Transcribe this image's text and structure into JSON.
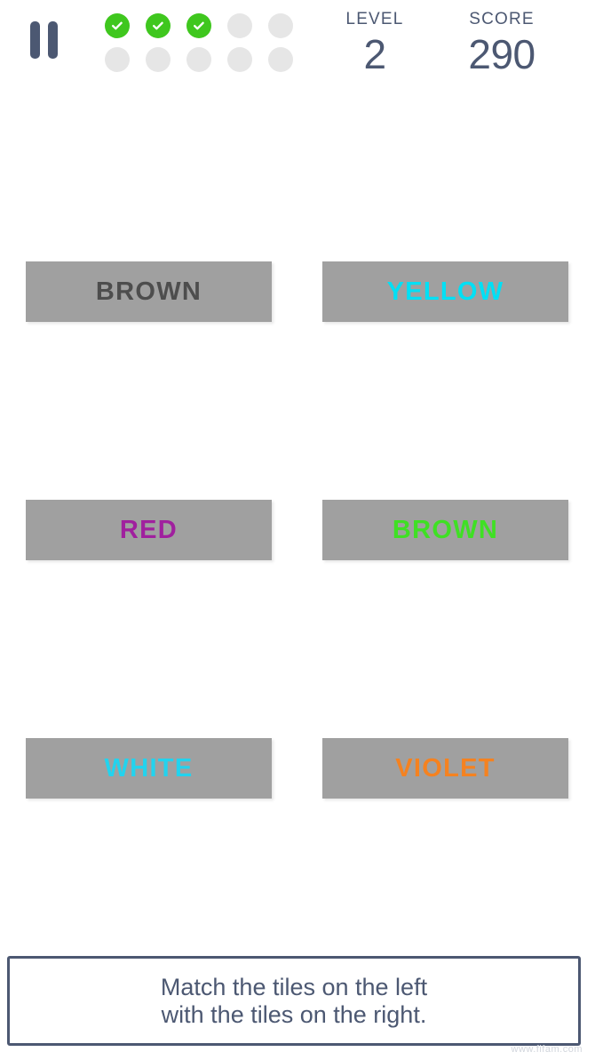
{
  "header": {
    "pause_icon": "pause-icon",
    "progress": {
      "rows": [
        [
          true,
          true,
          true,
          false,
          false
        ],
        [
          false,
          false,
          false,
          false,
          false
        ]
      ],
      "completed_count": 3,
      "total_count": 10,
      "done_color": "#3fc71e",
      "pending_color": "#e6e6e6"
    },
    "level": {
      "label": "LEVEL",
      "value": "2"
    },
    "score": {
      "label": "SCORE",
      "value": "290"
    },
    "text_color": "#4c5872"
  },
  "board": {
    "tile_background": "#a0a0a0",
    "rows": [
      {
        "left": {
          "text": "BROWN",
          "color": "#4d4d4d"
        },
        "right": {
          "text": "YELLOW",
          "color": "#00e0f5"
        }
      },
      {
        "left": {
          "text": "RED",
          "color": "#a0209e"
        },
        "right": {
          "text": "BROWN",
          "color": "#3fe024"
        }
      },
      {
        "left": {
          "text": "WHITE",
          "color": "#22d3ee"
        },
        "right": {
          "text": "VIOLET",
          "color": "#f58220"
        }
      }
    ]
  },
  "instruction": {
    "line1": "Match the tiles on the left",
    "line2": "with the tiles on the right.",
    "border_color": "#4c5872"
  },
  "watermark": {
    "text": "www.fifam.com"
  }
}
